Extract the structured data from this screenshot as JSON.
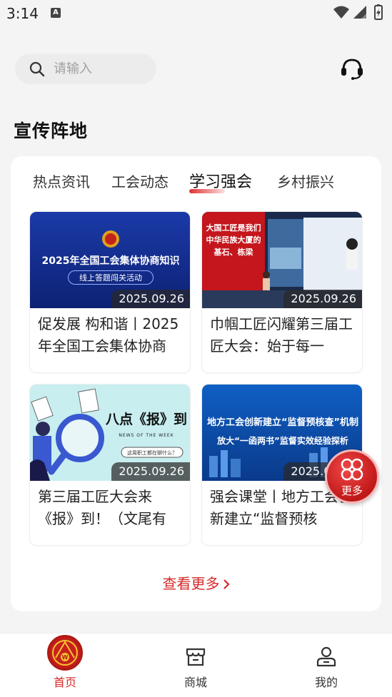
{
  "status": {
    "time": "3:14",
    "notification_letter": "A"
  },
  "search": {
    "placeholder": "请输入"
  },
  "section": {
    "title": "宣传阵地"
  },
  "tabs": [
    {
      "label": "热点资讯",
      "active": false
    },
    {
      "label": "工会动态",
      "active": false
    },
    {
      "label": "学习强会",
      "active": true
    },
    {
      "label": "乡村振兴",
      "active": false
    }
  ],
  "articles": [
    {
      "date": "2025.09.26",
      "title": "促发展 构和谐丨2025年全国工会集体协商",
      "thumb_headline": "2025年全国工会集体协商知识",
      "thumb_sub": "线上答题闯关活动"
    },
    {
      "date": "2025.09.26",
      "title": "巾帼工匠闪耀第三届工匠大会：始于每一",
      "thumb_headline": "大国工匠是我们中华民族大厦的基石、栋梁"
    },
    {
      "date": "2025.09.26",
      "title": "第三届工匠大会来《报》到！（文尾有",
      "thumb_headline": "八点《报》到",
      "thumb_sub": "NEWS OF THE WEEK",
      "thumb_tag": "这周职工都在聊什么？"
    },
    {
      "date": "2025.09.26",
      "title": "强会课堂丨地方工会创新建立“监督预核",
      "thumb_headline": "地方工会创新建立“监督预核查”机制",
      "thumb_sub": "放大“一函两书”监督实效经验探析"
    }
  ],
  "see_more": "查看更多",
  "float_button": {
    "label": "更多"
  },
  "nav": [
    {
      "label": "首页",
      "active": true,
      "icon": "union-emblem-icon"
    },
    {
      "label": "商城",
      "active": false,
      "icon": "store-icon"
    },
    {
      "label": "我的",
      "active": false,
      "icon": "user-icon"
    }
  ],
  "colors": {
    "accent": "#d42a2a",
    "background": "#f4f4f4",
    "card": "#ffffff"
  }
}
